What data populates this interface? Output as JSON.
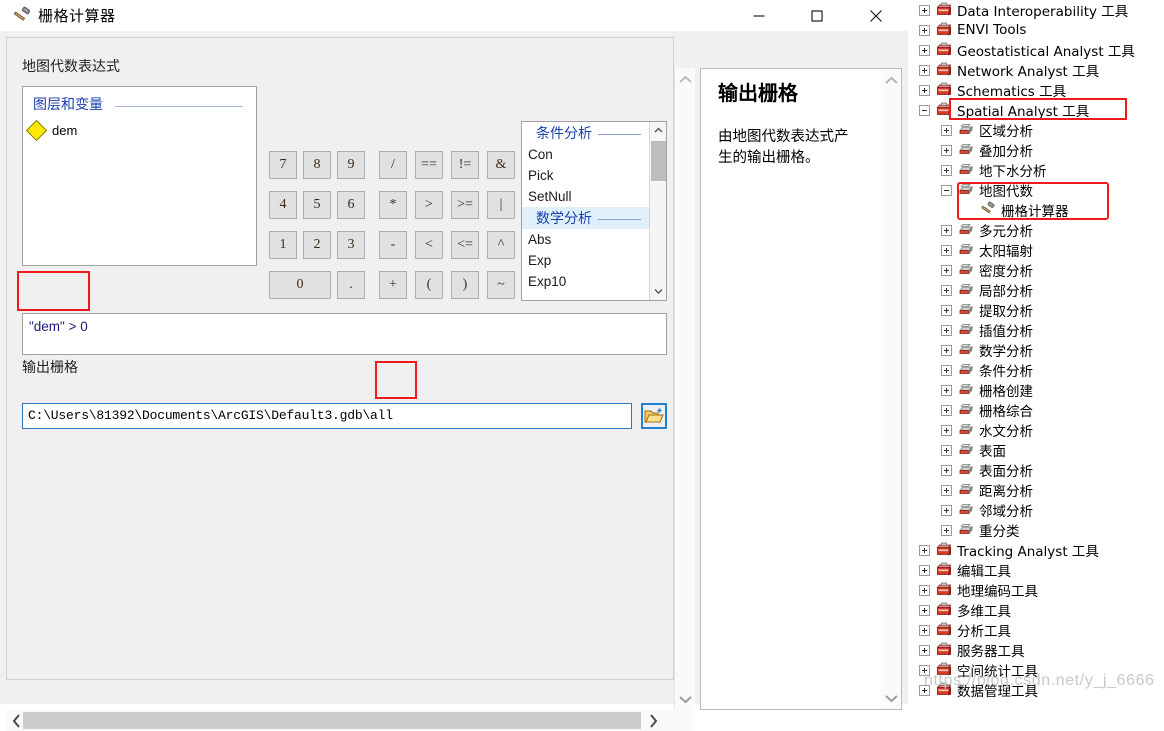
{
  "window": {
    "title": "栅格计算器",
    "icon": "hammer-icon",
    "minimize": "—",
    "maximize": "□",
    "close": "✕"
  },
  "dialog": {
    "map_algebra_label": "地图代数表达式",
    "output_raster_label": "输出栅格",
    "layers_panel": {
      "header": "图层和变量",
      "items": [
        {
          "name": "dem",
          "icon": "raster-layer-diamond-icon"
        }
      ]
    },
    "keypad": [
      "7",
      "8",
      "9",
      "/",
      "==",
      "!=",
      "&",
      "4",
      "5",
      "6",
      "*",
      ">",
      ">=",
      "|",
      "1",
      "2",
      "3",
      "-",
      "<",
      "<=",
      "^",
      "0",
      ".",
      "+",
      "(",
      ")",
      "~"
    ],
    "functions": [
      {
        "type": "group",
        "label": "条件分析",
        "selected": false
      },
      {
        "type": "item",
        "label": "Con"
      },
      {
        "type": "item",
        "label": "Pick"
      },
      {
        "type": "item",
        "label": "SetNull"
      },
      {
        "type": "group",
        "label": "数学分析",
        "selected": true
      },
      {
        "type": "item",
        "label": "Abs"
      },
      {
        "type": "item",
        "label": "Exp"
      },
      {
        "type": "item",
        "label": "Exp10"
      }
    ],
    "expression": "\"dem\" > 0",
    "output_path": "C:\\Users\\81392\\Documents\\ArcGIS\\Default3.gdb\\all",
    "browse_button": "folder-open-icon"
  },
  "help": {
    "title": "输出栅格",
    "body": "由地图代数表达式产生的输出栅格。"
  },
  "toolbox": {
    "nodes": [
      {
        "label": "Data Interoperability 工具",
        "indent": 0,
        "icon": "toolbox-icon",
        "expander": "plus"
      },
      {
        "label": "ENVI Tools",
        "indent": 0,
        "icon": "toolbox-icon",
        "expander": "plus"
      },
      {
        "label": "Geostatistical Analyst 工具",
        "indent": 0,
        "icon": "toolbox-icon",
        "expander": "plus"
      },
      {
        "label": "Network Analyst 工具",
        "indent": 0,
        "icon": "toolbox-icon",
        "expander": "plus"
      },
      {
        "label": "Schematics 工具",
        "indent": 0,
        "icon": "toolbox-icon",
        "expander": "plus"
      },
      {
        "label": "Spatial Analyst 工具",
        "indent": 0,
        "icon": "toolbox-icon",
        "expander": "minus"
      },
      {
        "label": "区域分析",
        "indent": 1,
        "icon": "toolset-icon",
        "expander": "plus"
      },
      {
        "label": "叠加分析",
        "indent": 1,
        "icon": "toolset-icon",
        "expander": "plus"
      },
      {
        "label": "地下水分析",
        "indent": 1,
        "icon": "toolset-icon",
        "expander": "plus"
      },
      {
        "label": "地图代数",
        "indent": 1,
        "icon": "toolset-icon",
        "expander": "minus"
      },
      {
        "label": "栅格计算器",
        "indent": 2,
        "icon": "hammer-icon",
        "expander": "none"
      },
      {
        "label": "多元分析",
        "indent": 1,
        "icon": "toolset-icon",
        "expander": "plus"
      },
      {
        "label": "太阳辐射",
        "indent": 1,
        "icon": "toolset-icon",
        "expander": "plus"
      },
      {
        "label": "密度分析",
        "indent": 1,
        "icon": "toolset-icon",
        "expander": "plus"
      },
      {
        "label": "局部分析",
        "indent": 1,
        "icon": "toolset-icon",
        "expander": "plus"
      },
      {
        "label": "提取分析",
        "indent": 1,
        "icon": "toolset-icon",
        "expander": "plus"
      },
      {
        "label": "插值分析",
        "indent": 1,
        "icon": "toolset-icon",
        "expander": "plus"
      },
      {
        "label": "数学分析",
        "indent": 1,
        "icon": "toolset-icon",
        "expander": "plus"
      },
      {
        "label": "条件分析",
        "indent": 1,
        "icon": "toolset-icon",
        "expander": "plus"
      },
      {
        "label": "栅格创建",
        "indent": 1,
        "icon": "toolset-icon",
        "expander": "plus"
      },
      {
        "label": "栅格综合",
        "indent": 1,
        "icon": "toolset-icon",
        "expander": "plus"
      },
      {
        "label": "水文分析",
        "indent": 1,
        "icon": "toolset-icon",
        "expander": "plus"
      },
      {
        "label": "表面",
        "indent": 1,
        "icon": "toolset-icon",
        "expander": "plus"
      },
      {
        "label": "表面分析",
        "indent": 1,
        "icon": "toolset-icon",
        "expander": "plus"
      },
      {
        "label": "距离分析",
        "indent": 1,
        "icon": "toolset-icon",
        "expander": "plus"
      },
      {
        "label": "邻域分析",
        "indent": 1,
        "icon": "toolset-icon",
        "expander": "plus"
      },
      {
        "label": "重分类",
        "indent": 1,
        "icon": "toolset-icon",
        "expander": "plus"
      },
      {
        "label": "Tracking Analyst 工具",
        "indent": 0,
        "icon": "toolbox-icon",
        "expander": "plus"
      },
      {
        "label": "编辑工具",
        "indent": 0,
        "icon": "toolbox-icon",
        "expander": "plus"
      },
      {
        "label": "地理编码工具",
        "indent": 0,
        "icon": "toolbox-icon",
        "expander": "plus"
      },
      {
        "label": "多维工具",
        "indent": 0,
        "icon": "toolbox-icon",
        "expander": "plus"
      },
      {
        "label": "分析工具",
        "indent": 0,
        "icon": "toolbox-icon",
        "expander": "plus"
      },
      {
        "label": "服务器工具",
        "indent": 0,
        "icon": "toolbox-icon",
        "expander": "plus"
      },
      {
        "label": "空间统计工具",
        "indent": 0,
        "icon": "toolbox-icon",
        "expander": "plus"
      },
      {
        "label": "数据管理工具",
        "indent": 0,
        "icon": "toolbox-icon",
        "expander": "plus"
      }
    ]
  },
  "watermark": "https://blog.csdn.net/y_j_6666",
  "colors": {
    "annotation_red": "#ef1b1b",
    "link_blue": "#1b40b0",
    "focus_blue": "#2d7ac0",
    "selection_blue": "#dff0fb"
  }
}
